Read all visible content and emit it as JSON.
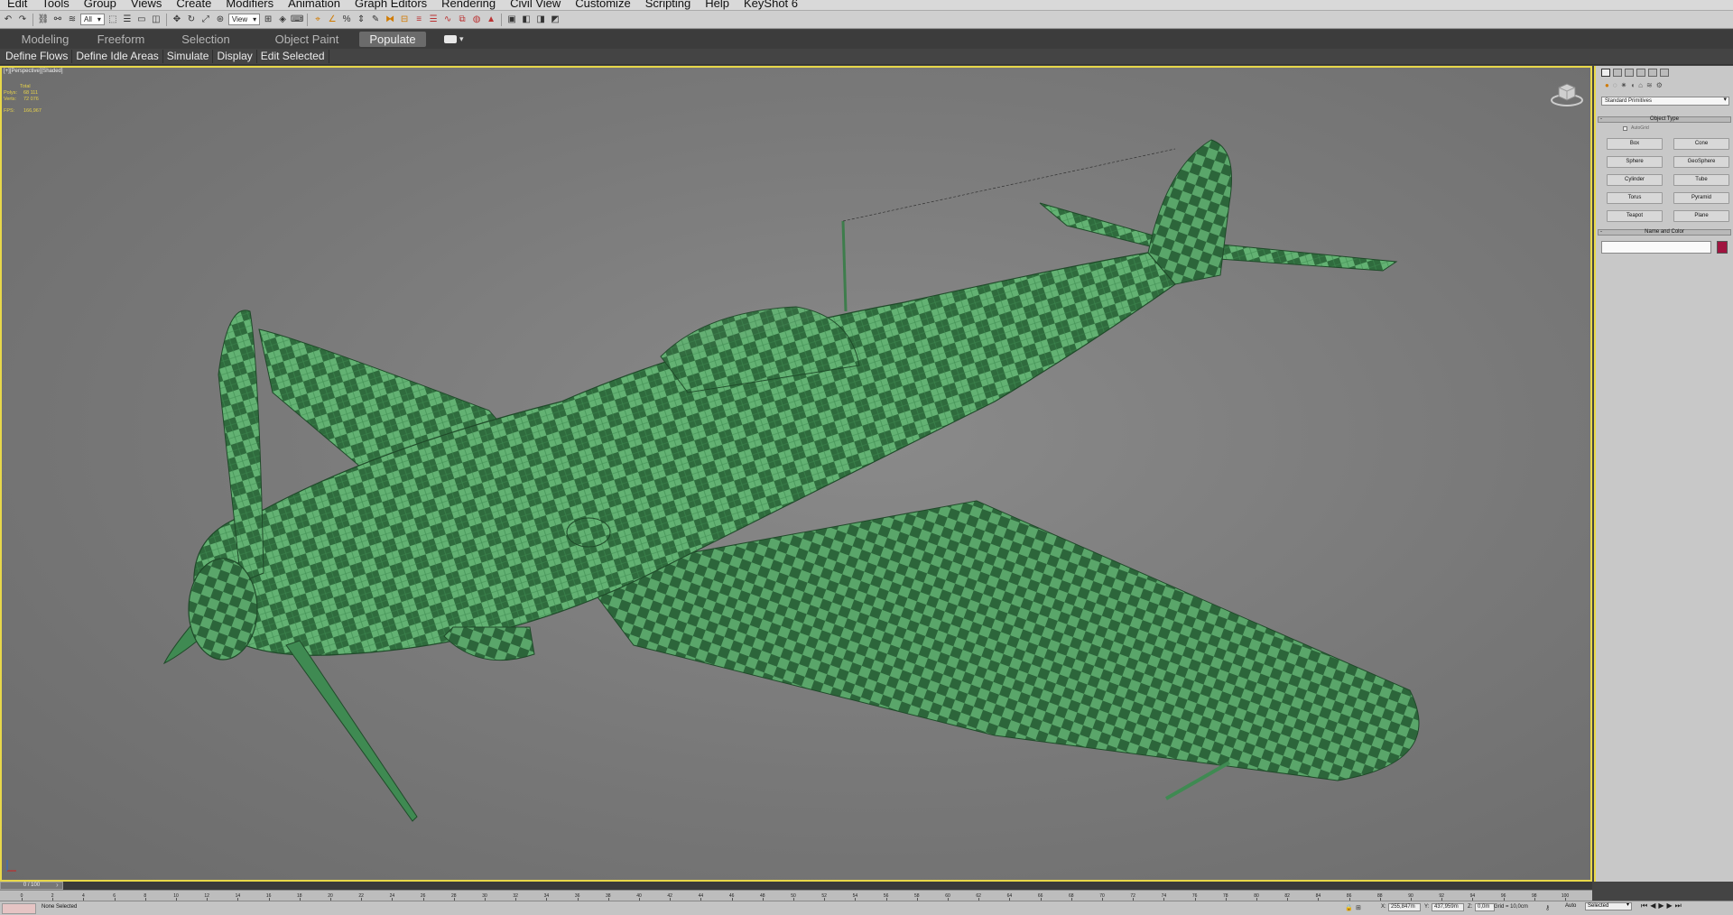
{
  "menu": [
    "Edit",
    "Tools",
    "Group",
    "Views",
    "Create",
    "Modifiers",
    "Animation",
    "Graph Editors",
    "Rendering",
    "Civil View",
    "Customize",
    "Scripting",
    "Help",
    "KeyShot 6"
  ],
  "toolbar": {
    "selection_filter": "All",
    "view_dropdown": "View"
  },
  "ribbon": {
    "tabs": [
      "Modeling",
      "Freeform",
      "Selection",
      "Object Paint",
      "Populate"
    ],
    "active_tab": "Populate"
  },
  "populate_bar": [
    "Define Flows",
    "Define Idle Areas",
    "Simulate",
    "Display",
    "Edit Selected"
  ],
  "viewport": {
    "label": "[+][Perspective][Shaded]",
    "stats": {
      "header": "Total",
      "rows": [
        {
          "k": "Polys:",
          "v": "68 111"
        },
        {
          "k": "Verts:",
          "v": "72 076"
        }
      ],
      "fps_label": "FPS:",
      "fps_value": "166,967"
    }
  },
  "command_panel": {
    "category": "Standard Primitives",
    "object_type_title": "Object Type",
    "autogrid": "AutoGrid",
    "primitives": [
      "Box",
      "Cone",
      "Sphere",
      "GeoSphere",
      "Cylinder",
      "Tube",
      "Torus",
      "Pyramid",
      "Teapot",
      "Plane"
    ],
    "name_color_title": "Name and Color",
    "object_color": "#a01440"
  },
  "timeline": {
    "frame_display": "0 / 100",
    "ticks": [
      "0",
      "2",
      "4",
      "6",
      "8",
      "10",
      "12",
      "14",
      "16",
      "18",
      "20",
      "22",
      "24",
      "26",
      "28",
      "30",
      "32",
      "34",
      "36",
      "38",
      "40",
      "42",
      "44",
      "46",
      "48",
      "50",
      "52",
      "54",
      "56",
      "58",
      "60",
      "62",
      "64",
      "66",
      "68",
      "70",
      "72",
      "74",
      "76",
      "78",
      "80",
      "82",
      "84",
      "86",
      "88",
      "90",
      "92",
      "94",
      "96",
      "98",
      "100"
    ]
  },
  "status": {
    "selection_status": "None Selected",
    "x_label": "X:",
    "x_value": "255,847m",
    "y_label": "Y:",
    "y_value": "437,959m",
    "z_label": "Z:",
    "z_value": "0,0m",
    "grid": "Grid = 10,0cm",
    "auto_key": "Auto",
    "selection_set": "Selected"
  },
  "colors": {
    "viewport_border": "#e8d84a",
    "plane_green": "#5aa66a",
    "plane_dark": "#2e6a3c"
  }
}
